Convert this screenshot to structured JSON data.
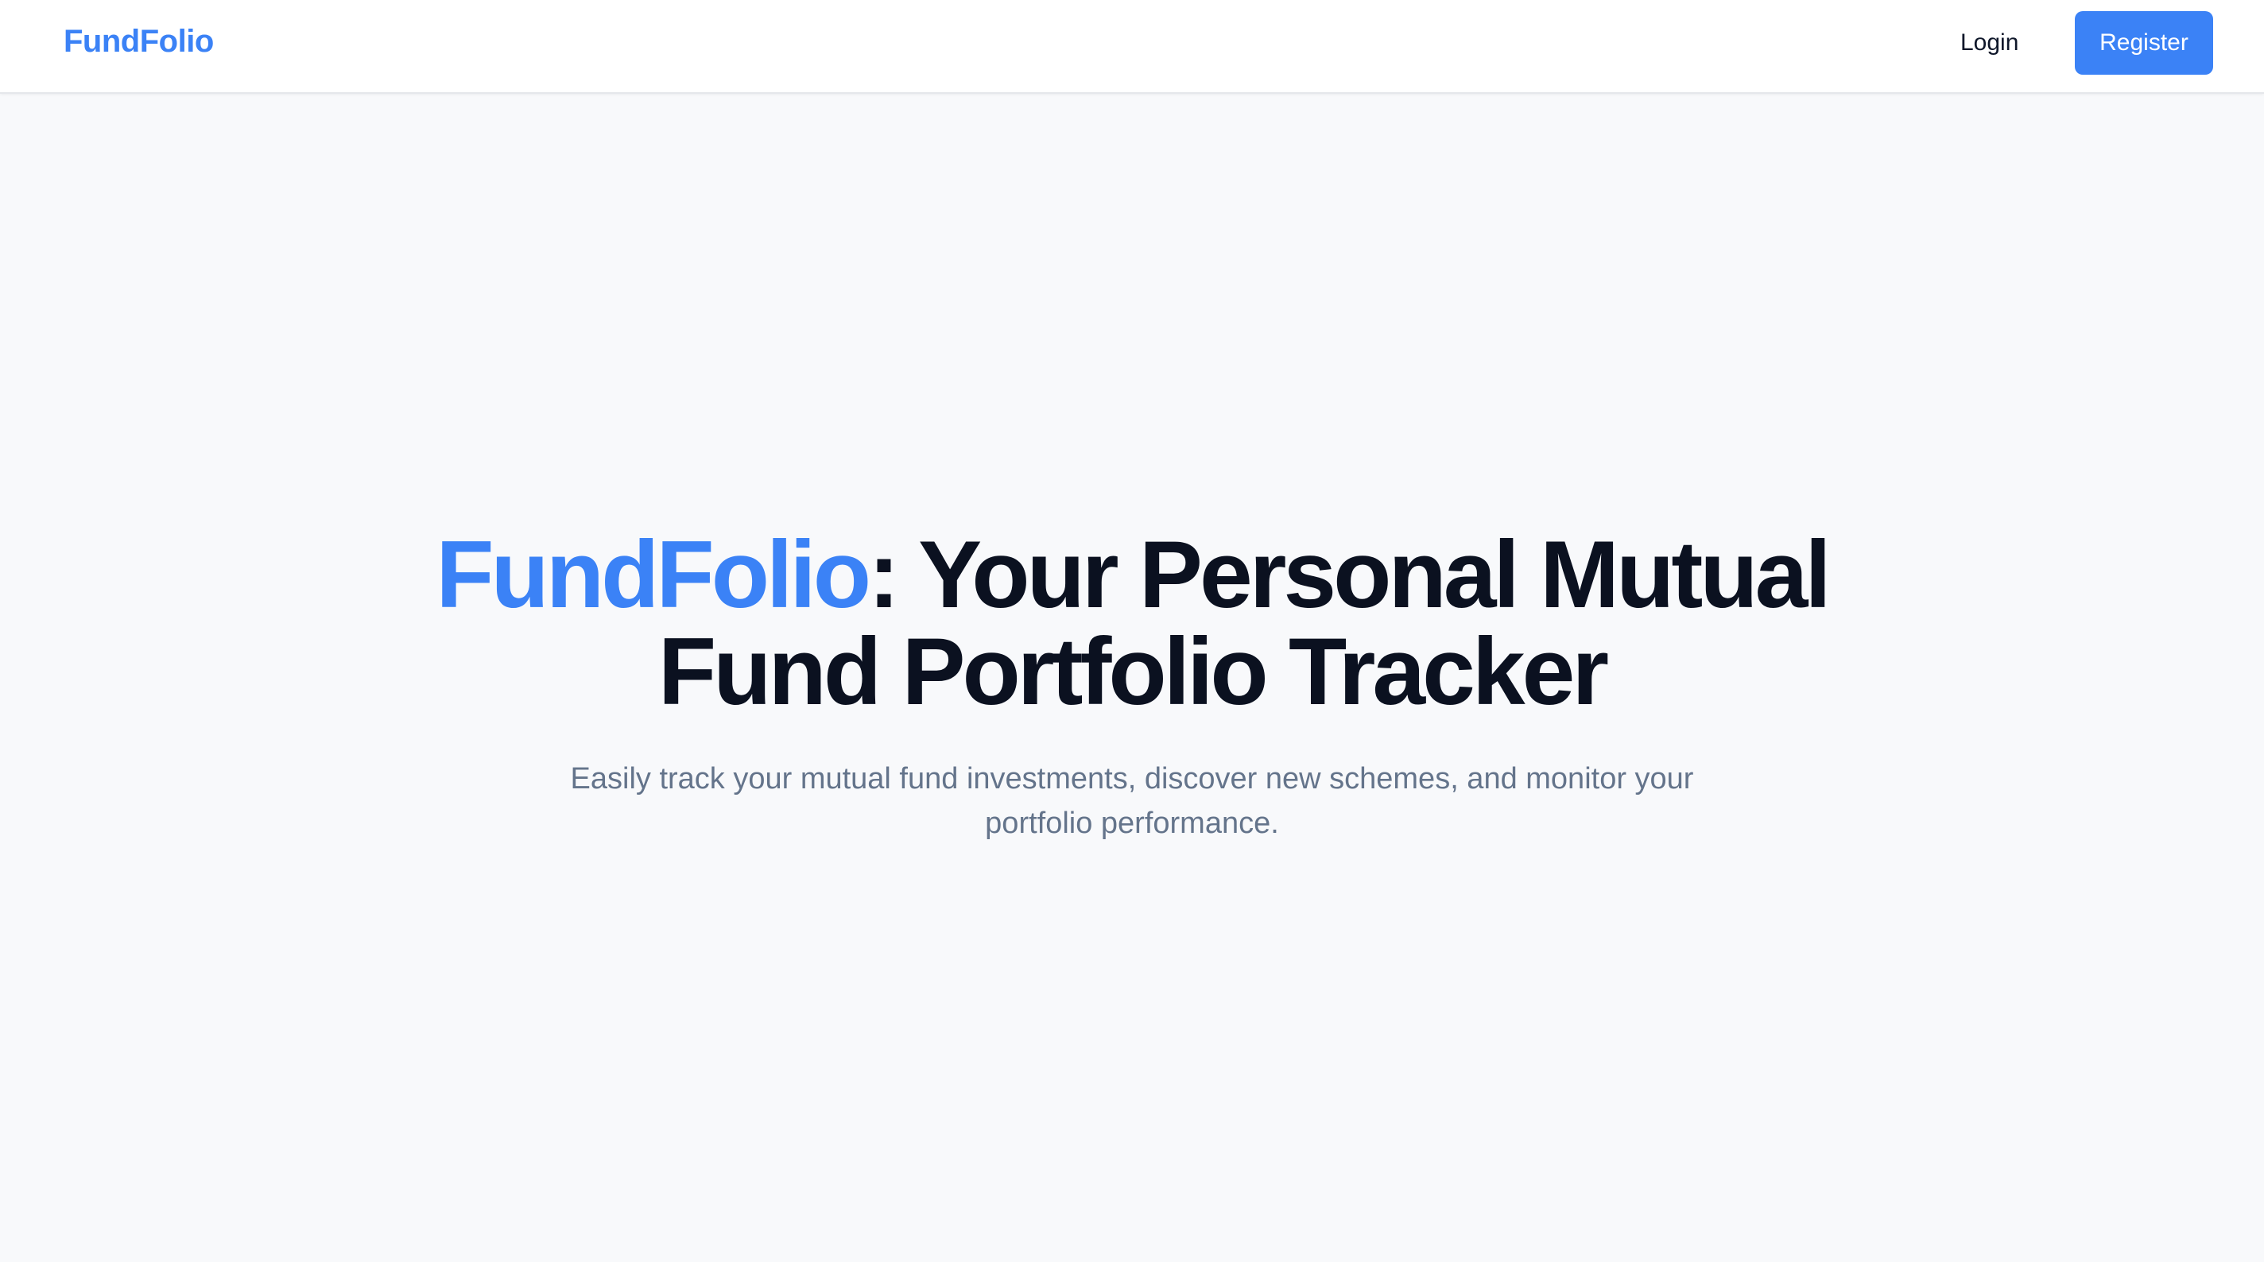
{
  "navbar": {
    "brand": "FundFolio",
    "login_label": "Login",
    "register_label": "Register"
  },
  "hero": {
    "title_accent": "FundFolio",
    "title_rest": ": Your Personal Mutual Fund Portfolio Tracker",
    "subtitle": "Easily track your mutual fund investments, discover new schemes, and monitor your portfolio performance."
  },
  "colors": {
    "accent": "#3b82f6",
    "heading": "#0b1120",
    "muted_text": "#64748b",
    "page_background": "#f8f9fb"
  }
}
